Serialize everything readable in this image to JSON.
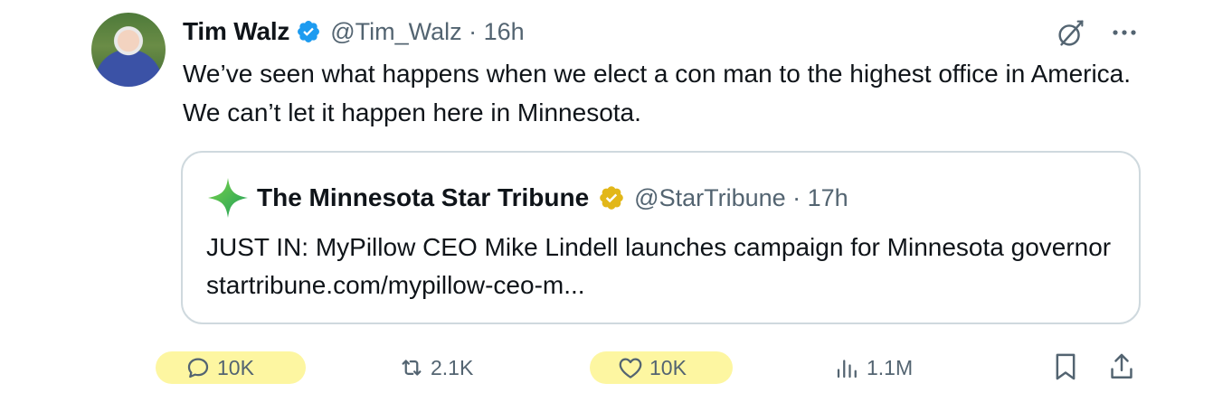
{
  "tweet": {
    "author_name": "Tim Walz",
    "handle_time": "@Tim_Walz · 16h",
    "text": "We’ve seen what happens when we elect a con man to the highest office in America. We can’t let it happen here in Minnesota."
  },
  "quote": {
    "author_name": "The Minnesota Star Tribune",
    "handle_time": "@StarTribune · 17h",
    "text": "JUST IN: MyPillow CEO Mike Lindell launches campaign for Minnesota governor startribune.com/mypillow-ceo-m..."
  },
  "actions": {
    "replies": "10K",
    "reposts": "2.1K",
    "likes": "10K",
    "views": "1.1M"
  },
  "colors": {
    "verified_blue": "#1d9bf0",
    "verified_gold": "#e2b719",
    "highlight": "#fdf6a1",
    "muted_text": "#536471",
    "border": "#cfd9de"
  },
  "icons": [
    "verified-badge-icon",
    "grok-icon",
    "more-icon",
    "star-tribune-logo-icon",
    "reply-icon",
    "repost-icon",
    "like-icon",
    "views-icon",
    "bookmark-icon",
    "share-icon"
  ]
}
